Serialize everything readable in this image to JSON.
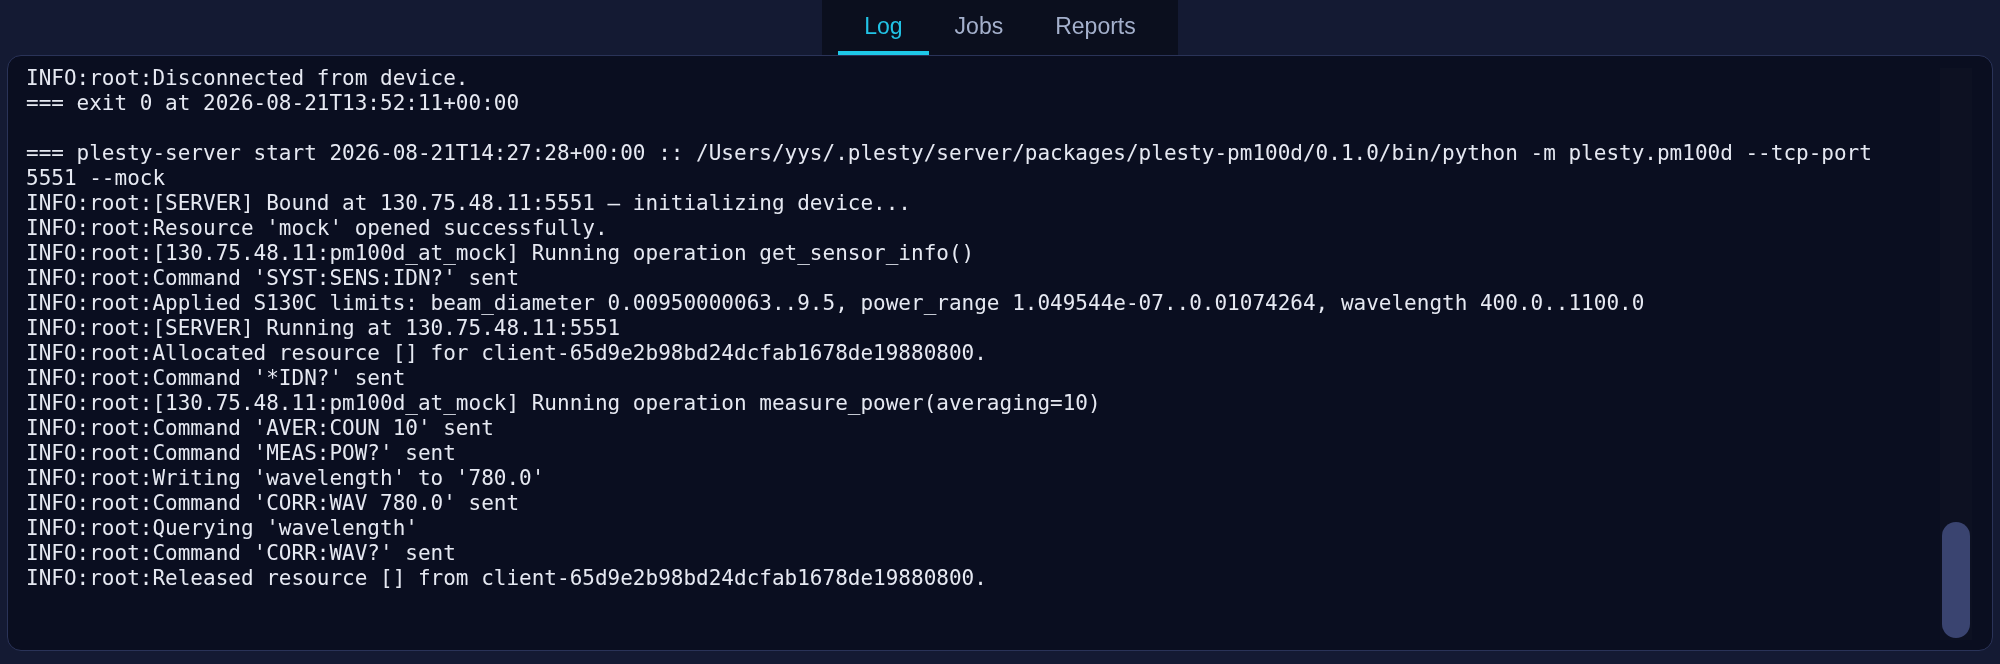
{
  "tabs": [
    {
      "label": "Log",
      "selected": true
    },
    {
      "label": "Jobs",
      "selected": false
    },
    {
      "label": "Reports",
      "selected": false
    }
  ],
  "log": {
    "blocks": [
      {
        "lines": [
          "INFO:root:Disconnected from device.",
          "=== exit 0 at 2026-08-21T13:52:11+00:00"
        ]
      },
      {
        "lines": [
          "=== plesty-server start 2026-08-21T14:27:28+00:00 :: /Users/yys/.plesty/server/packages/plesty-pm100d/0.1.0/bin/python -m plesty.pm100d --tcp-port 5551 --mock",
          "INFO:root:[SERVER] Bound at 130.75.48.11:5551 — initializing device...",
          "INFO:root:Resource 'mock' opened successfully.",
          "INFO:root:[130.75.48.11:pm100d_at_mock] Running operation get_sensor_info()",
          "INFO:root:Command 'SYST:SENS:IDN?' sent",
          "INFO:root:Applied S130C limits: beam_diameter 0.00950000063..9.5, power_range 1.049544e-07..0.01074264, wavelength 400.0..1100.0",
          "INFO:root:[SERVER] Running at 130.75.48.11:5551",
          "INFO:root:Allocated resource [] for client-65d9e2b98bd24dcfab1678de19880800.",
          "INFO:root:Command '*IDN?' sent",
          "INFO:root:[130.75.48.11:pm100d_at_mock] Running operation measure_power(averaging=10)",
          "INFO:root:Command 'AVER:COUN 10' sent",
          "INFO:root:Command 'MEAS:POW?' sent",
          "INFO:root:Writing 'wavelength' to '780.0'",
          "INFO:root:Command 'CORR:WAV 780.0' sent",
          "INFO:root:Querying 'wavelength'",
          "INFO:root:Command 'CORR:WAV?' sent",
          "INFO:root:Released resource [] from client-65d9e2b98bd24dcfab1678de19880800."
        ]
      }
    ]
  }
}
